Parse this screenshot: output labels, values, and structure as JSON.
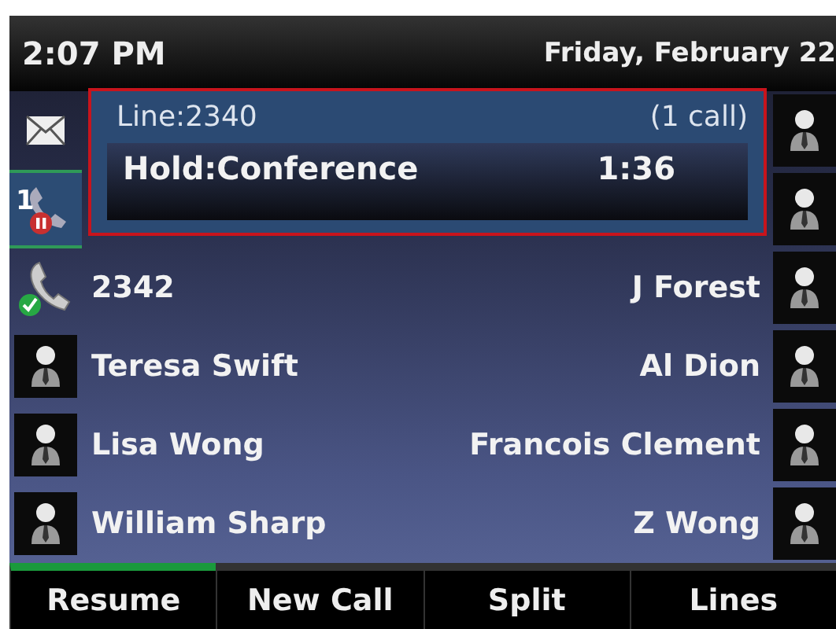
{
  "header": {
    "time": "2:07 PM",
    "date": "Friday, February 22"
  },
  "call_panel": {
    "line": "Line:2340",
    "count": "(1 call)",
    "status": "Hold:Conference",
    "timer": "1:36"
  },
  "left_keys": [
    {
      "kind": "messages",
      "selected": false
    },
    {
      "kind": "line-hold",
      "badge": "1",
      "selected": true
    },
    {
      "kind": "line-registered",
      "label": "2342",
      "selected": false
    },
    {
      "kind": "contact",
      "label": "Teresa Swift",
      "selected": false
    },
    {
      "kind": "contact",
      "label": "Lisa Wong",
      "selected": false
    },
    {
      "kind": "contact",
      "label": "William Sharp",
      "selected": false
    }
  ],
  "right_keys": [
    {
      "kind": "contact"
    },
    {
      "kind": "contact"
    },
    {
      "kind": "contact",
      "label": "J Forest"
    },
    {
      "kind": "contact",
      "label": "Al Dion"
    },
    {
      "kind": "contact",
      "label": "Francois Clement"
    },
    {
      "kind": "contact",
      "label": "Z Wong"
    }
  ],
  "softkeys": [
    {
      "label": "Resume",
      "selected": true
    },
    {
      "label": "New Call",
      "selected": false
    },
    {
      "label": "Split",
      "selected": false
    },
    {
      "label": "Lines",
      "selected": false
    }
  ]
}
